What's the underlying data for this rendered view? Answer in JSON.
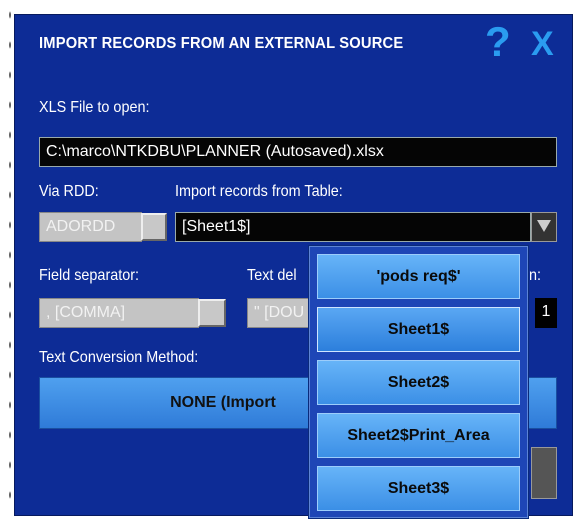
{
  "dialog": {
    "title": "IMPORT RECORDS FROM AN EXTERNAL SOURCE",
    "help_glyph": "?",
    "close_glyph": "X"
  },
  "file": {
    "label": "XLS File to open:",
    "value": "C:\\marco\\NTKDBU\\PLANNER (Autosaved).xlsx"
  },
  "rdd": {
    "label": "Via RDD:",
    "value": "ADORDD"
  },
  "table": {
    "label": "Import records from Table:",
    "value": "[Sheet1$]"
  },
  "separator": {
    "label": "Field separator:",
    "value": ", [COMMA]"
  },
  "delimiter": {
    "label_visible": "Text del",
    "value_visible": "\" [DOU"
  },
  "hidden_field": {
    "label_visible": "n:",
    "value": "1"
  },
  "conversion": {
    "label": "Text Conversion Method:",
    "button_visible": "NONE (Import"
  },
  "dropdown_options": [
    "'pods req$'",
    "Sheet1$",
    "Sheet2$",
    "Sheet2$Print_Area",
    "Sheet3$"
  ],
  "colors": {
    "dialog_bg": "#0d2c96",
    "accent": "#2a9cf0",
    "option_bg": "#4fa0ef"
  }
}
